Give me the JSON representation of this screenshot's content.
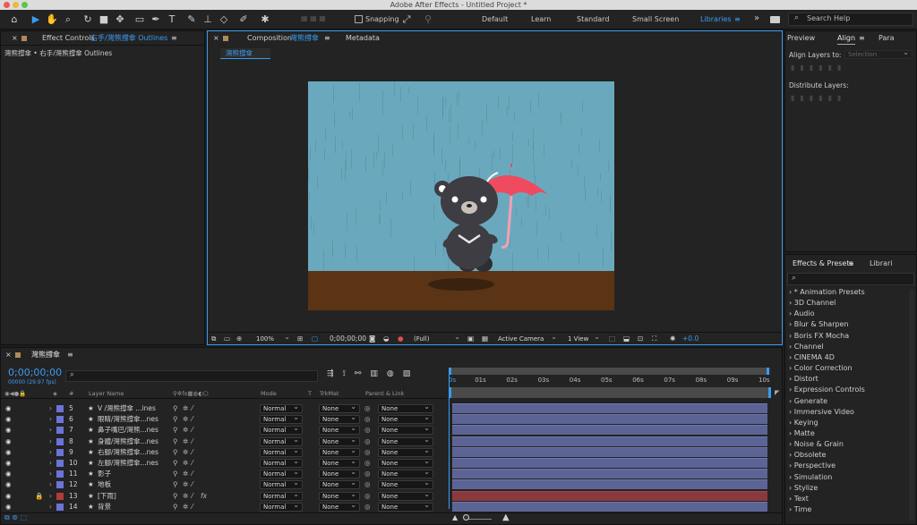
{
  "window": {
    "title": "Adobe After Effects - Untitled Project *"
  },
  "toolbar": {
    "snapping_label": "Snapping",
    "workspaces": [
      "Default",
      "Learn",
      "Standard",
      "Small Screen",
      "Libraries"
    ],
    "more": "»",
    "search_placeholder": "Search Help"
  },
  "effect_controls": {
    "tab_prefix": "Effect Controls",
    "tab_layer": "右手/灣熊撐傘 Outlines",
    "subtitle": "灣熊撐傘 • 右手/灣熊撐傘 Outlines"
  },
  "composition": {
    "tab_prefix": "Composition",
    "tab_name": "灣熊撐傘",
    "metadata_tab": "Metadata",
    "subtab": "灣熊撐傘",
    "zoom": "100%",
    "timecode": "0;00;00;00",
    "resolution": "(Full)",
    "camera": "Active Camera",
    "views": "1 View",
    "exposure": "+0.0"
  },
  "right_panel": {
    "tabs": [
      "Preview",
      "Align",
      "Para"
    ],
    "align_layers_to": "Align Layers to:",
    "align_target": "Selection",
    "distribute_layers": "Distribute Layers:"
  },
  "effects_presets": {
    "tabs": [
      "Effects & Presets",
      "Librari"
    ],
    "search_placeholder": "",
    "items": [
      "* Animation Presets",
      "3D Channel",
      "Audio",
      "Blur & Sharpen",
      "Boris FX Mocha",
      "Channel",
      "CINEMA 4D",
      "Color Correction",
      "Distort",
      "Expression Controls",
      "Generate",
      "Immersive Video",
      "Keying",
      "Matte",
      "Noise & Grain",
      "Obsolete",
      "Perspective",
      "Simulation",
      "Stylize",
      "Text",
      "Time"
    ]
  },
  "timeline": {
    "tab_name": "灣熊撐傘",
    "timecode": "0;00;00;00",
    "frame_info": "00000 (29.97 fps)",
    "search_placeholder": "",
    "columns": {
      "num": "#",
      "layer_name": "Layer Name",
      "mode": "Mode",
      "t": "T",
      "trkmat": "TrkMat",
      "parent": "Parent & Link"
    },
    "ruler": [
      "0s",
      "01s",
      "02s",
      "03s",
      "04s",
      "05s",
      "06s",
      "07s",
      "08s",
      "09s",
      "10s"
    ],
    "layers": [
      {
        "num": "5",
        "name": "V /灣熊撐傘 ...ines",
        "mode": "Normal",
        "trkmat": "None",
        "parent": "None",
        "color": "#6b74d8",
        "locked": false,
        "fx": false
      },
      {
        "num": "6",
        "name": "眼睛/灣熊撐傘...nes",
        "mode": "Normal",
        "trkmat": "None",
        "parent": "None",
        "color": "#6b74d8",
        "locked": false,
        "fx": false
      },
      {
        "num": "7",
        "name": "鼻子嘴巴/灣熊...nes",
        "mode": "Normal",
        "trkmat": "None",
        "parent": "None",
        "color": "#6b74d8",
        "locked": false,
        "fx": false
      },
      {
        "num": "8",
        "name": "身體/灣熊撐傘...nes",
        "mode": "Normal",
        "trkmat": "None",
        "parent": "None",
        "color": "#6b74d8",
        "locked": false,
        "fx": false
      },
      {
        "num": "9",
        "name": "右腳/灣熊撐傘...nes",
        "mode": "Normal",
        "trkmat": "None",
        "parent": "None",
        "color": "#6b74d8",
        "locked": false,
        "fx": false
      },
      {
        "num": "10",
        "name": "左腳/灣熊撐傘...nes",
        "mode": "Normal",
        "trkmat": "None",
        "parent": "None",
        "color": "#6b74d8",
        "locked": false,
        "fx": false
      },
      {
        "num": "11",
        "name": "影子",
        "mode": "Normal",
        "trkmat": "None",
        "parent": "None",
        "color": "#6b74d8",
        "locked": false,
        "fx": false
      },
      {
        "num": "12",
        "name": "地板",
        "mode": "Normal",
        "trkmat": "None",
        "parent": "None",
        "color": "#6b74d8",
        "locked": false,
        "fx": false
      },
      {
        "num": "13",
        "name": "[下雨]",
        "mode": "Normal",
        "trkmat": "None",
        "parent": "None",
        "color": "#b23a3a",
        "locked": true,
        "fx": true
      },
      {
        "num": "14",
        "name": "背景",
        "mode": "Normal",
        "trkmat": "None",
        "parent": "None",
        "color": "#6b74d8",
        "locked": false,
        "fx": false
      }
    ]
  },
  "colors": {
    "accent": "#3b9bf1",
    "sky": "#6aa9bd",
    "ground": "#5a3414",
    "umbrella": "#ee4a60",
    "bear": "#3e3d43"
  }
}
